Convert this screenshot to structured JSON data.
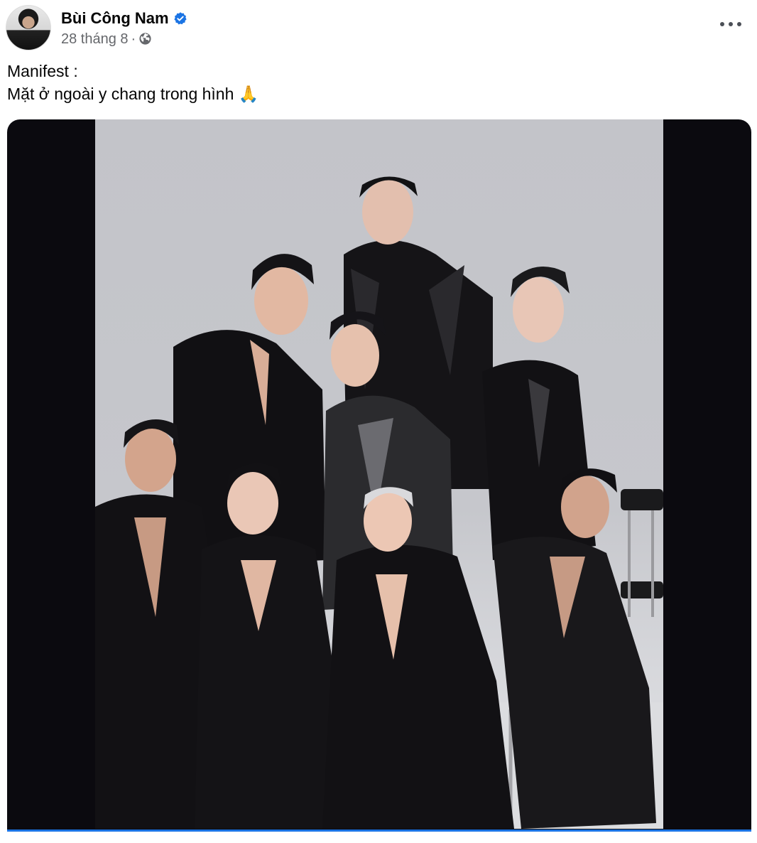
{
  "post": {
    "author": "Bùi Công Nam",
    "verified": true,
    "timestamp": "28 tháng 8",
    "separator": "·",
    "audience_icon": "globe-icon",
    "caption_lines": [
      "Manifest :",
      "Mặt ở ngoài y chang trong hình 🙏"
    ]
  },
  "colors": {
    "accent": "#1b74e4",
    "secondary_text": "#65676b",
    "media_background": "#0b0a0f"
  }
}
